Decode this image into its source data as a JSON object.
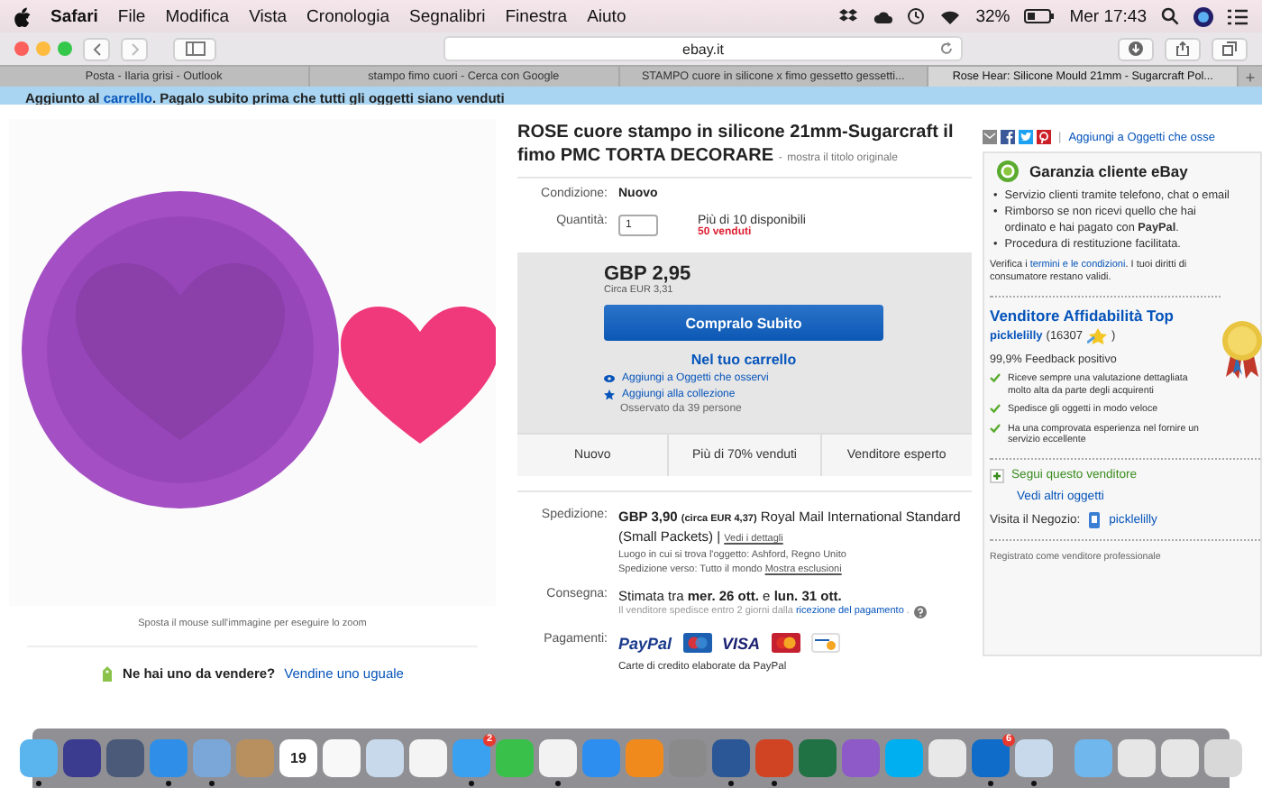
{
  "menubar": {
    "app": "Safari",
    "menus": [
      "File",
      "Modifica",
      "Vista",
      "Cronologia",
      "Segnalibri",
      "Finestra",
      "Aiuto"
    ],
    "battery": "32%",
    "clock": "Mer 17:43"
  },
  "toolbar": {
    "url": "ebay.it"
  },
  "tabs": [
    {
      "title": "Posta - Ilaria grisi - Outlook",
      "selected": false
    },
    {
      "title": "stampo fimo cuori - Cerca con Google",
      "selected": false
    },
    {
      "title": "STAMPO cuore in silicone x fimo gessetto gessetti...",
      "selected": false
    },
    {
      "title": "Rose Hear: Silicone Mould 21mm - Sugarcraft Pol...",
      "selected": true
    }
  ],
  "new_tab": "+",
  "banner": {
    "before": "Aggiunto al ",
    "link": "carrello",
    "after": ". Pagalo subito prima che tutti gli oggetti siano venduti"
  },
  "gallery": {
    "hint": "Sposta il mouse sull'immagine per eseguire lo zoom"
  },
  "sell_prompt": {
    "question": "Ne hai uno da vendere?",
    "link": "Vendine uno uguale"
  },
  "listing": {
    "title": "ROSE cuore stampo in silicone 21mm-Sugarcraft il fimo PMC TORTA DECORARE",
    "title_dash": "-",
    "original_title_link": "mostra il titolo originale",
    "condition_label": "Condizione:",
    "condition": "Nuovo",
    "quantity_label": "Quantità:",
    "quantity": "1",
    "available": "Più di 10 disponibili",
    "sold": "50 venduti",
    "price": "GBP 2,95",
    "price_converted": "Circa EUR 3,31",
    "buy_button": "Compralo Subito",
    "cart_link": "Nel tuo carrello",
    "watch_link": "Aggiungi a Oggetti che osservi",
    "collection_link": "Aggiungi alla collezione",
    "watchers": "Osservato da 39 persone",
    "highlights": [
      "Nuovo",
      "Più di 70% venduti",
      "Venditore esperto"
    ]
  },
  "shipping": {
    "label": "Spedizione:",
    "price": "GBP 3,90",
    "converted": "(circa EUR 4,37)",
    "service": "Royal Mail International Standard (Small Packets)",
    "separator": "|",
    "details_link": "Vedi i dettagli",
    "location": "Luogo in cui si trova l'oggetto:  Ashford, Regno Unito",
    "ships_to": "Spedizione verso:  Tutto il mondo",
    "exclusions_link": "Mostra esclusioni"
  },
  "delivery": {
    "label": "Consegna:",
    "estimate": "Stimata tra **mer. 26 ott.** e **lun. 31 ott.**",
    "dispatch": "Il venditore spedisce entro 2 giorni dalla ",
    "dispatch_link": "ricezione del pagamento",
    "dispatch_end": " ."
  },
  "payments": {
    "label": "Pagamenti:",
    "paypal": "PayPal",
    "visa": "VISA",
    "note": "Carte di credito elaborate da PayPal"
  },
  "share": {
    "separator": "|",
    "watch_link": "Aggiungi a Oggetti che osse"
  },
  "guarantee": {
    "title": "Garanzia cliente eBay",
    "bullet": "•",
    "bullets": [
      "Servizio clienti tramite telefono, chat o email",
      "Rimborso se non ricevi quello che hai ordinato e hai pagato con **PayPal**.",
      "Procedura di restituzione facilitata."
    ],
    "note_before": "Verifica i ",
    "note_link": "termini e le condizioni",
    "note_after": ". I tuoi diritti di consumatore restano validi."
  },
  "seller": {
    "badge_title": "Venditore Affidabilità Top",
    "name": "picklelilly",
    "score": "(16307",
    "score_close": ")",
    "feedback": "99,9% Feedback positivo",
    "points": [
      "Riceve sempre una valutazione dettagliata molto alta da parte degli acquirenti",
      "Spedisce gli oggetti in modo veloce",
      "Ha una comprovata esperienza nel fornire un servizio eccellente"
    ],
    "follow_link": "Segui questo venditore",
    "other_items_link": "Vedi altri oggetti",
    "store_label": "Visita il Negozio:",
    "store_link": "picklelilly",
    "registered": "Registrato come venditore professionale"
  },
  "dock": [
    {
      "kind": "finder",
      "running": true
    },
    {
      "kind": "siri",
      "running": false
    },
    {
      "kind": "launchpad",
      "running": false
    },
    {
      "kind": "safari",
      "running": true
    },
    {
      "kind": "mail",
      "running": true
    },
    {
      "kind": "contacts",
      "running": false
    },
    {
      "kind": "calendar",
      "label": "19",
      "running": false
    },
    {
      "kind": "reminders",
      "running": false
    },
    {
      "kind": "preview",
      "running": false
    },
    {
      "kind": "photos",
      "running": false
    },
    {
      "kind": "messages",
      "badge": "2",
      "running": true
    },
    {
      "kind": "facetime",
      "running": false
    },
    {
      "kind": "music",
      "running": true
    },
    {
      "kind": "appstore",
      "running": false
    },
    {
      "kind": "books",
      "running": false
    },
    {
      "kind": "settings",
      "running": false
    },
    {
      "kind": "word",
      "running": true
    },
    {
      "kind": "powerpoint",
      "running": true
    },
    {
      "kind": "excel",
      "running": false
    },
    {
      "kind": "display",
      "running": false
    },
    {
      "kind": "skype",
      "running": false
    },
    {
      "kind": "chrome",
      "running": false
    },
    {
      "kind": "cloud",
      "badge": "6",
      "running": true
    },
    {
      "kind": "preview",
      "running": true
    },
    {
      "kind": "separator"
    },
    {
      "kind": "folder",
      "running": false
    },
    {
      "kind": "window",
      "running": false
    },
    {
      "kind": "window",
      "running": false
    },
    {
      "kind": "trash",
      "running": false
    }
  ]
}
